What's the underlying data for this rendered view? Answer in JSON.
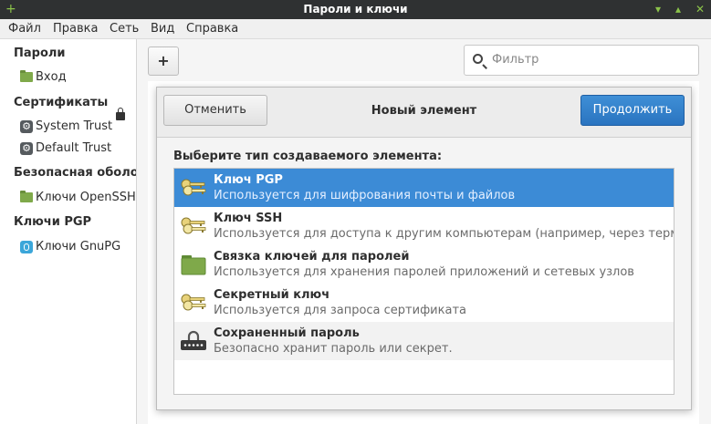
{
  "window": {
    "title": "Пароли и ключи"
  },
  "menu": [
    "Файл",
    "Правка",
    "Сеть",
    "Вид",
    "Справка"
  ],
  "sidebar": {
    "sections": [
      {
        "title": "Пароли",
        "items": [
          {
            "label": "Вход",
            "icon": "folder-icon",
            "locked": true
          }
        ]
      },
      {
        "title": "Сертификаты",
        "items": [
          {
            "label": "System Trust",
            "icon": "gear-icon"
          },
          {
            "label": "Default Trust",
            "icon": "gear-icon"
          }
        ]
      },
      {
        "title": "Безопасная оболочка",
        "items": [
          {
            "label": "Ключи OpenSSH",
            "icon": "folder-icon"
          }
        ]
      },
      {
        "title": "Ключи PGP",
        "items": [
          {
            "label": "Ключи GnuPG",
            "icon": "gnupg-icon"
          }
        ]
      }
    ]
  },
  "toolbar": {
    "add_label": "+",
    "filter_placeholder": "Фильтр"
  },
  "dialog": {
    "cancel_label": "Отменить",
    "title": "Новый элемент",
    "continue_label": "Продолжить",
    "prompt": "Выберите тип создаваемого элемента:",
    "items": [
      {
        "name": "Ключ PGP",
        "desc": "Используется для шифрования почты и файлов",
        "icon": "keys-icon",
        "selected": true
      },
      {
        "name": "Ключ SSH",
        "desc": "Используется для доступа к другим компьютерам (например, через терминал)",
        "icon": "keys-icon"
      },
      {
        "name": "Связка ключей для паролей",
        "desc": "Используется для хранения паролей приложений и сетевых узлов",
        "icon": "folder-icon"
      },
      {
        "name": "Секретный ключ",
        "desc": "Используется для запроса сертификата",
        "icon": "keys-icon"
      },
      {
        "name": "Сохраненный пароль",
        "desc": "Безопасно хранит пароль или секрет.",
        "icon": "lock-password-icon",
        "hovered": true
      }
    ]
  },
  "colors": {
    "accent": "#3c8bd6",
    "titlebar": "#2f3132",
    "folder": "#7fa94a"
  }
}
